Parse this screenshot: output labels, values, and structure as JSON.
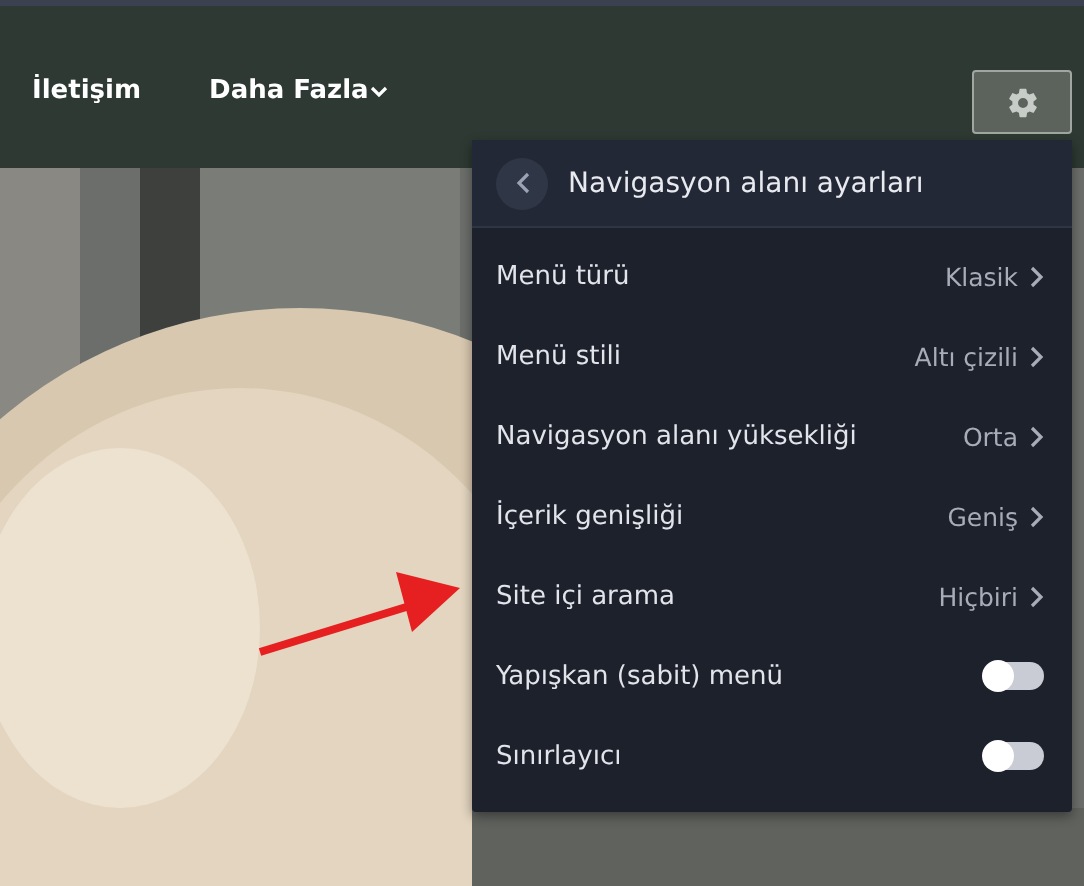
{
  "nav": {
    "links": [
      {
        "label": "İletişim",
        "dropdown": false
      },
      {
        "label": "Daha Fazla",
        "dropdown": true
      }
    ]
  },
  "settings_panel": {
    "title": "Navigasyon alanı ayarları",
    "rows": [
      {
        "kind": "select",
        "label": "Menü türü",
        "value": "Klasik"
      },
      {
        "kind": "select",
        "label": "Menü stili",
        "value": "Altı çizili"
      },
      {
        "kind": "select",
        "label": "Navigasyon alanı yüksekliği",
        "value": "Orta"
      },
      {
        "kind": "select",
        "label": "İçerik genişliği",
        "value": "Geniş"
      },
      {
        "kind": "select",
        "label": "Site içi arama",
        "value": "Hiçbiri"
      },
      {
        "kind": "toggle",
        "label": "Yapışkan (sabit) menü",
        "on": false
      },
      {
        "kind": "toggle",
        "label": "Sınırlayıcı",
        "on": false
      }
    ]
  }
}
